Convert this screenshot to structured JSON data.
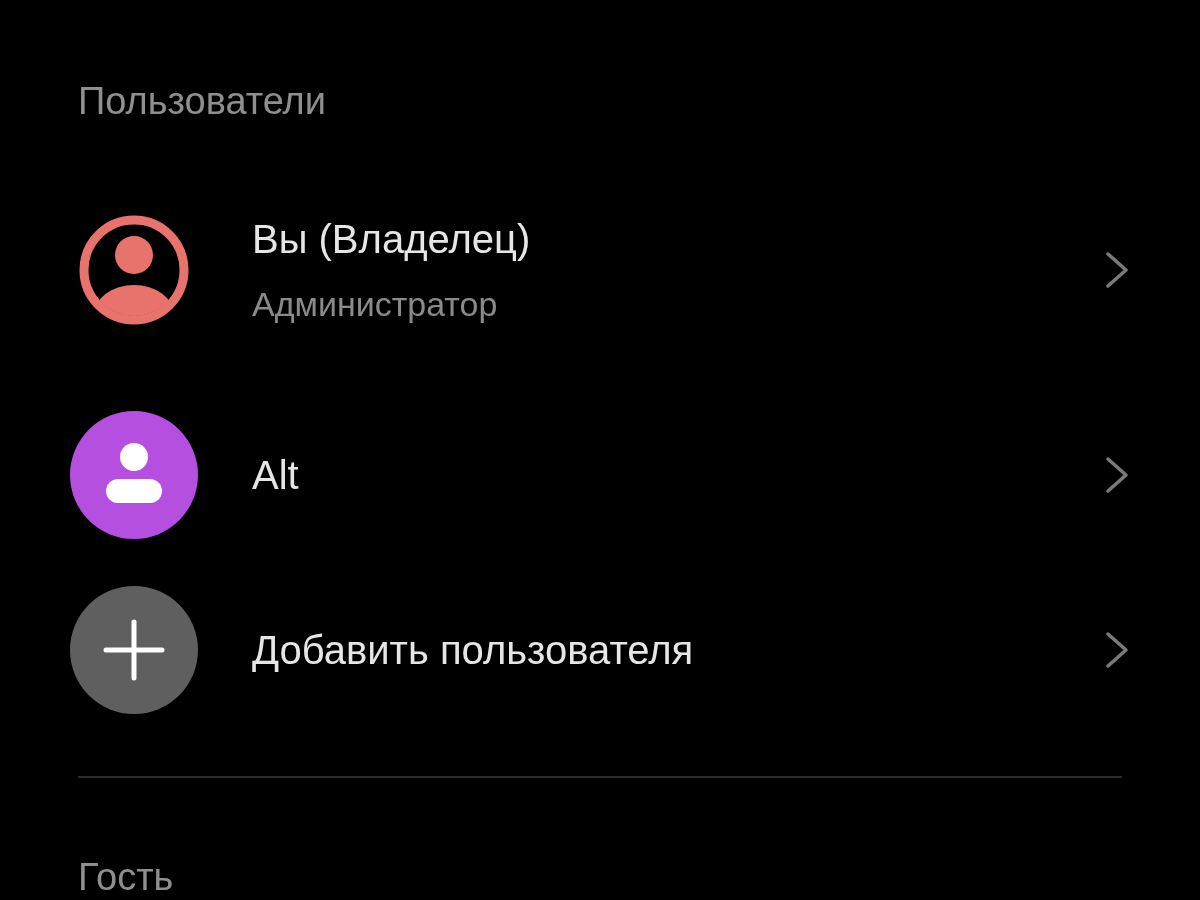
{
  "sections": [
    {
      "header": "Пользователи",
      "items": [
        {
          "kind": "owner",
          "title": "Вы (Владелец)",
          "subtitle": "Администратор",
          "color": "#e8736c"
        },
        {
          "kind": "user",
          "title": "Alt",
          "color": "#b44fe0"
        },
        {
          "kind": "add",
          "title": "Добавить пользователя",
          "color": "#5f5f5f"
        }
      ]
    },
    {
      "header": "Гость"
    }
  ]
}
